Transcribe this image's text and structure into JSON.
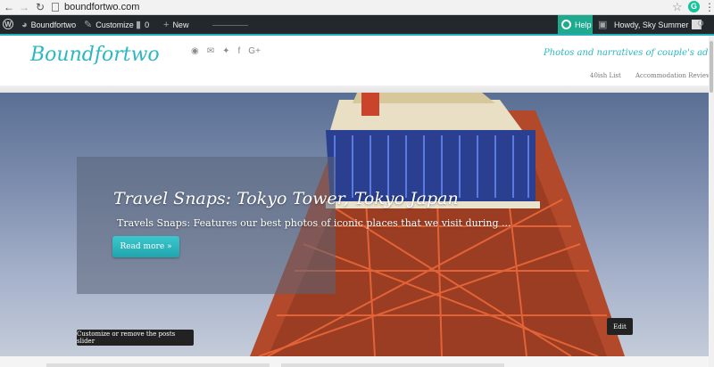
{
  "browser": {
    "url": "boundfortwo.com",
    "icons": [
      "back-arrow-icon",
      "forward-arrow-icon",
      "reload-icon",
      "page-icon",
      "star-icon",
      "grammarly-icon",
      "menu-icon"
    ],
    "extension_letter": "G"
  },
  "admin_bar": {
    "site_name": "Boundfortwo",
    "customize": "Customize",
    "comments_count": "0",
    "new_label": "New",
    "help_label": "Help",
    "howdy": "Howdy, Sky Summer",
    "bg_color": "#23282d",
    "help_color": "#1eaa8f"
  },
  "header": {
    "site_title": "Boundfortwo",
    "tagline": "Photos and narratives of couple's adventure",
    "social_icons": [
      "rss-icon",
      "email-icon",
      "twitter-icon",
      "facebook-icon",
      "google-plus-icon"
    ],
    "menu": [
      "40ish List",
      "Accommodation Review"
    ],
    "accent_color": "#2bb8c2"
  },
  "slider": {
    "title": "Travel Snaps: Tokyo Tower, Tokyo Japan",
    "excerpt": "Travels Snaps: Features our best photos of iconic places that we visit during ...",
    "read_more": "Read more »",
    "customize_label": "Customize or remove the posts slider",
    "edit_label": "Edit",
    "button_color": "#2bb8c2"
  }
}
